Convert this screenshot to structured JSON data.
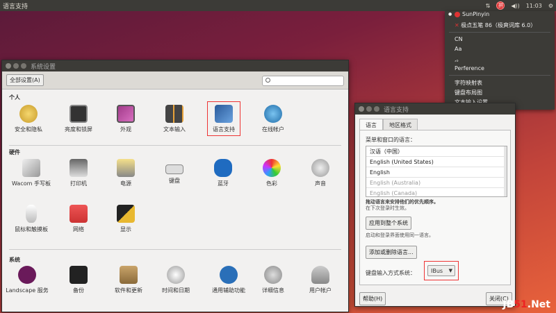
{
  "topbar": {
    "title": "语言支持",
    "tray": {
      "ime_label": "拼",
      "volume": "◀))",
      "time": "11:03",
      "updown": "⇅"
    }
  },
  "ime_menu": {
    "items": [
      {
        "label": "SunPinyin",
        "selected": true
      },
      {
        "label": "极点五笔 86（极爽词库 6.0）",
        "selected": false
      },
      {
        "label": "CN"
      },
      {
        "label": "Aa"
      },
      {
        "label": ",。"
      },
      {
        "label": "Perference"
      },
      {
        "label": "字符映射表"
      },
      {
        "label": "键盘布局图"
      },
      {
        "label": "文本输入设置..."
      }
    ]
  },
  "settings_window": {
    "title": "系统设置",
    "all_settings": "全部设置(A)",
    "search_placeholder": "",
    "sections": [
      {
        "title": "个人",
        "items": [
          {
            "label": "安全和隐私",
            "icon": "privacy-icon"
          },
          {
            "label": "亮度和锁屏",
            "icon": "brightness-lock-icon"
          },
          {
            "label": "外观",
            "icon": "appearance-icon"
          },
          {
            "label": "文本输入",
            "icon": "text-entry-icon"
          },
          {
            "label": "语言支持",
            "icon": "language-support-icon"
          },
          {
            "label": "在线帐户",
            "icon": "online-accounts-icon"
          }
        ]
      },
      {
        "title": "硬件",
        "items": [
          {
            "label": "Wacom 手写板",
            "icon": "wacom-tablet-icon"
          },
          {
            "label": "打印机",
            "icon": "printer-icon"
          },
          {
            "label": "电源",
            "icon": "power-icon"
          },
          {
            "label": "键盘",
            "icon": "keyboard-icon"
          },
          {
            "label": "蓝牙",
            "icon": "bluetooth-icon"
          },
          {
            "label": "色彩",
            "icon": "color-icon"
          },
          {
            "label": "声音",
            "icon": "sound-icon"
          },
          {
            "label": "鼠标和触摸板",
            "icon": "mouse-touchpad-icon"
          },
          {
            "label": "网络",
            "icon": "network-icon"
          },
          {
            "label": "显示",
            "icon": "display-icon"
          }
        ]
      },
      {
        "title": "系统",
        "items": [
          {
            "label": "Landscape 服务",
            "icon": "landscape-icon"
          },
          {
            "label": "备份",
            "icon": "backup-icon"
          },
          {
            "label": "软件和更新",
            "icon": "software-updates-icon"
          },
          {
            "label": "时间和日期",
            "icon": "time-date-icon"
          },
          {
            "label": "通用辅助功能",
            "icon": "accessibility-icon"
          },
          {
            "label": "详细信息",
            "icon": "details-icon"
          },
          {
            "label": "用户帐户",
            "icon": "user-accounts-icon"
          }
        ]
      }
    ]
  },
  "lang_window": {
    "title": "语言支持",
    "tabs": [
      "语言",
      "地区格式"
    ],
    "list_caption": "菜单和窗口的语言：",
    "languages": [
      {
        "label": "汉语（中国）",
        "dim": false
      },
      {
        "label": "English (United States)",
        "dim": false
      },
      {
        "label": "English",
        "dim": false
      },
      {
        "label": "English (Australia)",
        "dim": true
      },
      {
        "label": "English (Canada)",
        "dim": true
      }
    ],
    "drag_hint": "拖动语言来安排他们的优先顺序。",
    "drag_hint2": "在下次登录时生效。",
    "apply_system": "应用到整个系统",
    "apply_hint": "启动和登录界面使用同一语言。",
    "add_remove": "添加或删除语言...",
    "im_label": "键盘输入方式系统：",
    "im_value": "IBus",
    "help": "帮助(H)",
    "close": "关闭(C)"
  },
  "watermark": {
    "prefix": "JB",
    "num": "51",
    "suffix": ".Net"
  },
  "colors": {
    "accent_red": "#e33333",
    "panel_dark": "#3c3b37"
  }
}
